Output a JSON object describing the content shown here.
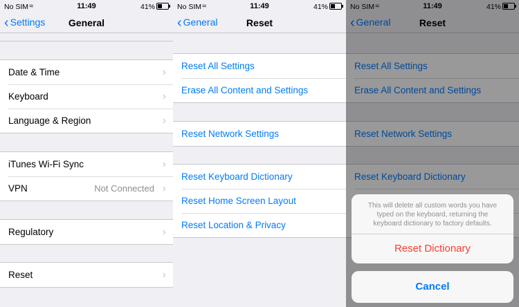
{
  "status": {
    "carrier": "No SIM",
    "time": "11:49",
    "battery": "41%"
  },
  "general": {
    "back_label": "Settings",
    "title": "General",
    "rows": {
      "date_time": "Date & Time",
      "keyboard": "Keyboard",
      "language_region": "Language & Region",
      "itunes_wifi_sync": "iTunes Wi-Fi Sync",
      "vpn": "VPN",
      "vpn_status": "Not Connected",
      "regulatory": "Regulatory",
      "reset": "Reset"
    }
  },
  "reset": {
    "back_label": "General",
    "title": "Reset",
    "rows": {
      "reset_all": "Reset All Settings",
      "erase_all": "Erase All Content and Settings",
      "reset_network": "Reset Network Settings",
      "reset_keyboard": "Reset Keyboard Dictionary",
      "reset_home": "Reset Home Screen Layout",
      "reset_location": "Reset Location & Privacy"
    }
  },
  "action_sheet": {
    "message": "This will delete all custom words you have typed on the keyboard, returning the keyboard dictionary to factory defaults.",
    "destructive_label": "Reset Dictionary",
    "cancel_label": "Cancel"
  },
  "colors": {
    "accent": "#007aff",
    "destructive": "#ff3b30",
    "background": "#efeff4"
  },
  "icons": {
    "back": "chevron-left-icon",
    "disclosure": "chevron-right-icon",
    "wifi": "wifi-icon",
    "battery": "battery-icon"
  }
}
